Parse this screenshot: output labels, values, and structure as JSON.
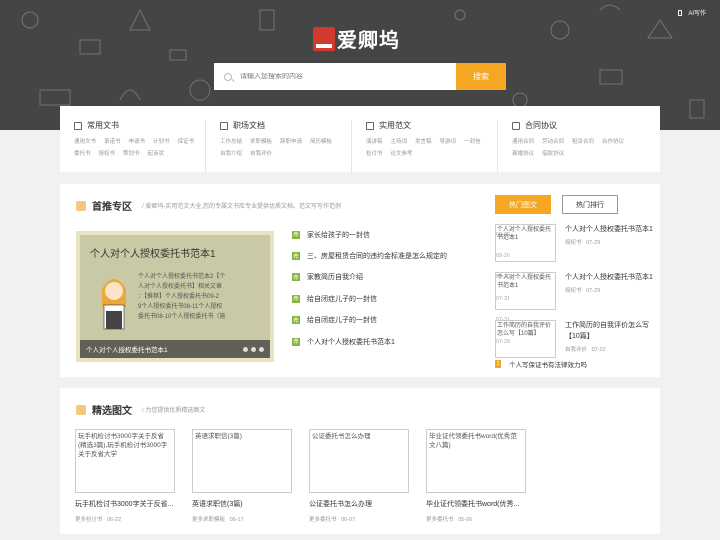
{
  "header": {
    "ai_writing": "AI写作",
    "logo_text": "爱卿坞",
    "search_placeholder": "请输入您搜索的内容",
    "search_button": "搜索"
  },
  "categories": [
    {
      "title": "常用文书",
      "links": [
        "通用文书",
        "承诺书",
        "申请书",
        "计划书",
        "保证书",
        "委托书",
        "授权书",
        "策划书",
        "起诉状"
      ]
    },
    {
      "title": "职场文档",
      "links": [
        "工作总结",
        "求职模板",
        "辞职申请",
        "简历模板",
        "自我介绍",
        "自我评价"
      ]
    },
    {
      "title": "实用范文",
      "links": [
        "演讲稿",
        "主持词",
        "发言稿",
        "导游词",
        "一封信",
        "检讨书",
        "论文参考"
      ]
    },
    {
      "title": "合同协议",
      "links": [
        "通用合同",
        "劳动合同",
        "租赁合同",
        "合作协议",
        "离婚协议",
        "借款协议"
      ]
    }
  ],
  "featured": {
    "title": "首推专区",
    "subtitle": "/ 爱卿坞-实用范文大全,您的专属文书库专业提供优质文档、范文写写作范例",
    "slide": {
      "heading": "个人对个人授权委托书范本1",
      "lines": [
        "个人对个人授权委托书范本2【个",
        "人对个人授权委托书】相关文章",
        "：【推荐】个人授权委托书09-2",
        "9个人授权委托书08-11个人授权",
        "委托书08-10个人授权委托书（施"
      ],
      "caption": "个人对个人授权委托书范本1"
    },
    "news": [
      {
        "badge": "荐",
        "title": "家长给孩子的一封信",
        "date": "08-20"
      },
      {
        "badge": "荐",
        "title": "三、房屋租赁合同的违约金标准是怎么规定的",
        "date": "08-20"
      },
      {
        "badge": "荐",
        "title": "家教简历自我介绍",
        "date": "08-20"
      },
      {
        "badge": "荐",
        "title": "给自闭症儿子的一封信",
        "date": "07-31"
      },
      {
        "badge": "荐",
        "title": "给自闭症儿子的一封信",
        "date": "07-31"
      },
      {
        "badge": "荐",
        "title": "个人对个人授权委托书范本1",
        "date": "07-29"
      }
    ],
    "tabs": [
      "热门图文",
      "热门排行"
    ],
    "hot": [
      {
        "img_alt": "个人对个人授权委托书范本1",
        "title": "个人对个人授权委托书范本1",
        "category": "授权书",
        "date": "07-29"
      },
      {
        "img_alt": "个人对个人授权委托书范本1",
        "title": "个人对个人授权委托书范本1",
        "category": "授权书",
        "date": "07-29"
      },
      {
        "img_alt": "工作简历的自我评价怎么写【10篇】",
        "title": "工作简历的自我评价怎么写【10篇】",
        "category": "自我评价",
        "date": "07-22"
      }
    ],
    "hot_last": {
      "num": "1",
      "title": "个人写保证书有法律效力吗"
    }
  },
  "picks": {
    "title": "精选图文",
    "subtitle": "/ 为您提供优质精选图文",
    "cards": [
      {
        "img_alt": "玩手机检讨书3000字关于反省(精选3篇),玩手机检讨书3000字关于反省大学",
        "title": "玩手机检讨书3000字关于反省...",
        "category": "更多检讨书",
        "date": "06-22"
      },
      {
        "img_alt": "英语求职信(3篇)",
        "title": "英语求职信(3篇)",
        "category": "更多求职模板",
        "date": "06-17"
      },
      {
        "img_alt": "公证委托书怎么办理",
        "title": "公证委托书怎么办理",
        "category": "更多委托书",
        "date": "06-07"
      },
      {
        "img_alt": "毕业证代领委托书word(优秀范文八篇)",
        "title": "毕业证代领委托书word(优秀...",
        "category": "更多委托书",
        "date": "05-06"
      }
    ]
  },
  "colors": {
    "accent": "#f5a623",
    "badge_green": "#8ab640",
    "hero_bg": "#454545"
  }
}
